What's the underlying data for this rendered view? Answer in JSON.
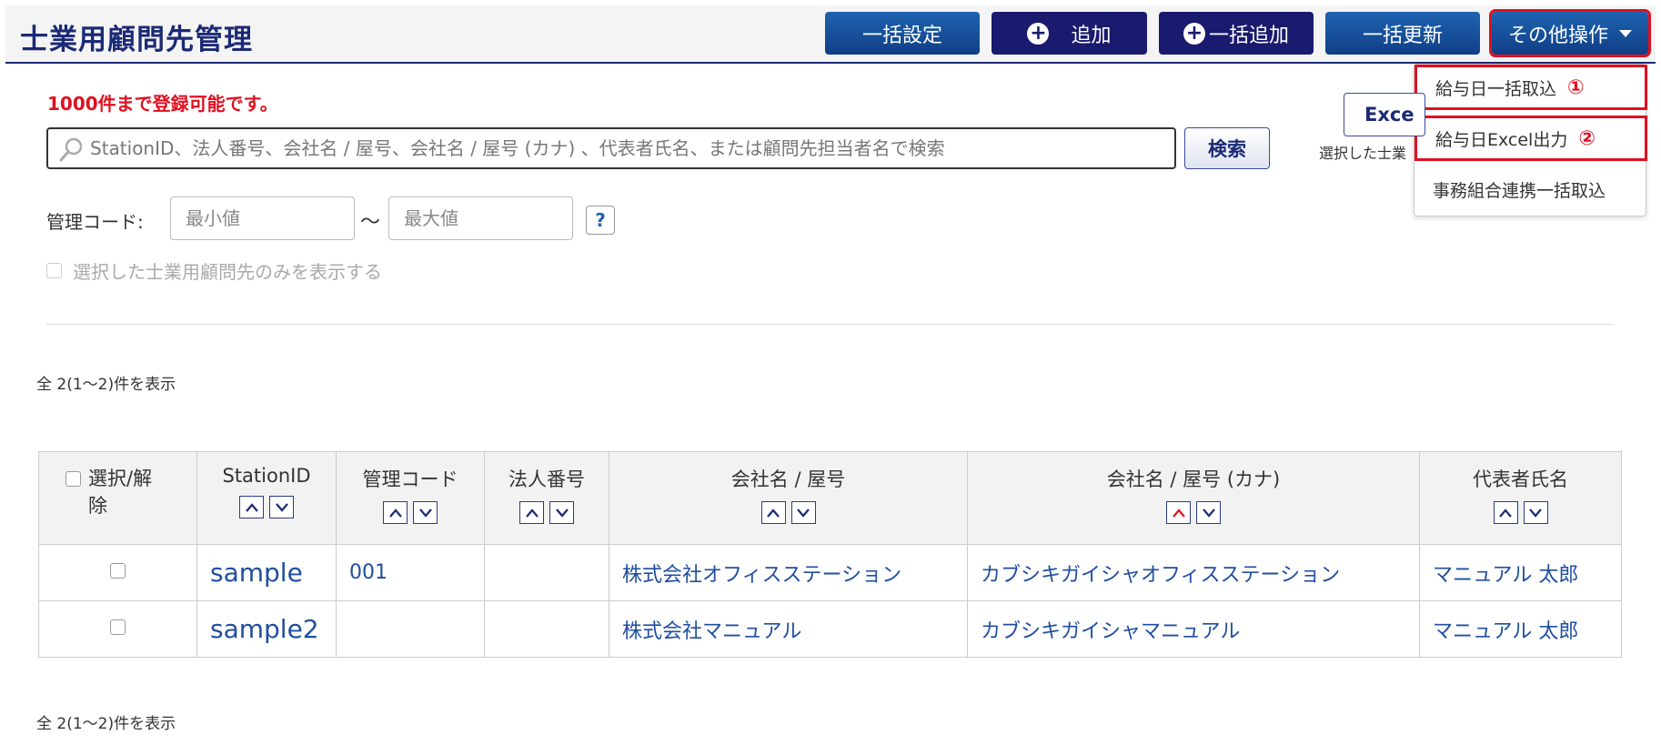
{
  "header": {
    "title": "士業用顧問先管理",
    "buttons": {
      "bulk_setting": "一括設定",
      "add": "追加",
      "bulk_add": "一括追加",
      "bulk_update": "一括更新",
      "other_ops": "その他操作"
    }
  },
  "dropdown": {
    "items": [
      {
        "label": "給与日一括取込",
        "badge": "①"
      },
      {
        "label": "給与日Excel出力",
        "badge": "②"
      },
      {
        "label": "事務組合連携一括取込",
        "badge": ""
      }
    ]
  },
  "notice": "1000件まで登録可能です。",
  "search": {
    "placeholder": "StationID、法人番号、会社名 / 屋号、会社名 / 屋号 (カナ) 、代表者氏名、または顧問先担当者名で検索",
    "button": "検索"
  },
  "excel": {
    "button": "Exce",
    "note": "選択した士業"
  },
  "filters": {
    "mgmt_label": "管理コード:",
    "min_placeholder": "最小値",
    "max_placeholder": "最大値",
    "tilde": "～",
    "help": "?",
    "only_selected": "選択した士業用顧問先のみを表示する"
  },
  "count_text": "全 2(1～2)件を表示",
  "table": {
    "headers": {
      "select": "選択/解除",
      "station_id": "StationID",
      "mgmt_code": "管理コード",
      "corp_no": "法人番号",
      "company": "会社名 / 屋号",
      "company_kana": "会社名 / 屋号 (カナ)",
      "rep": "代表者氏名"
    },
    "rows": [
      {
        "station_id": "sample",
        "mgmt_code": "001",
        "corp_no": "",
        "company": "株式会社オフィスステーション",
        "company_kana": "カブシキガイシャオフィスステーション",
        "rep": "マニュアル 太郎"
      },
      {
        "station_id": "sample2",
        "mgmt_code": "",
        "corp_no": "",
        "company": "株式会社マニュアル",
        "company_kana": "カブシキガイシャマニュアル",
        "rep": "マニュアル 太郎"
      }
    ]
  },
  "colors": {
    "navy": "#1b2a75",
    "button_blue": "#0f3f86",
    "highlight_red": "#e01020",
    "link_blue": "#1f4ea0"
  }
}
